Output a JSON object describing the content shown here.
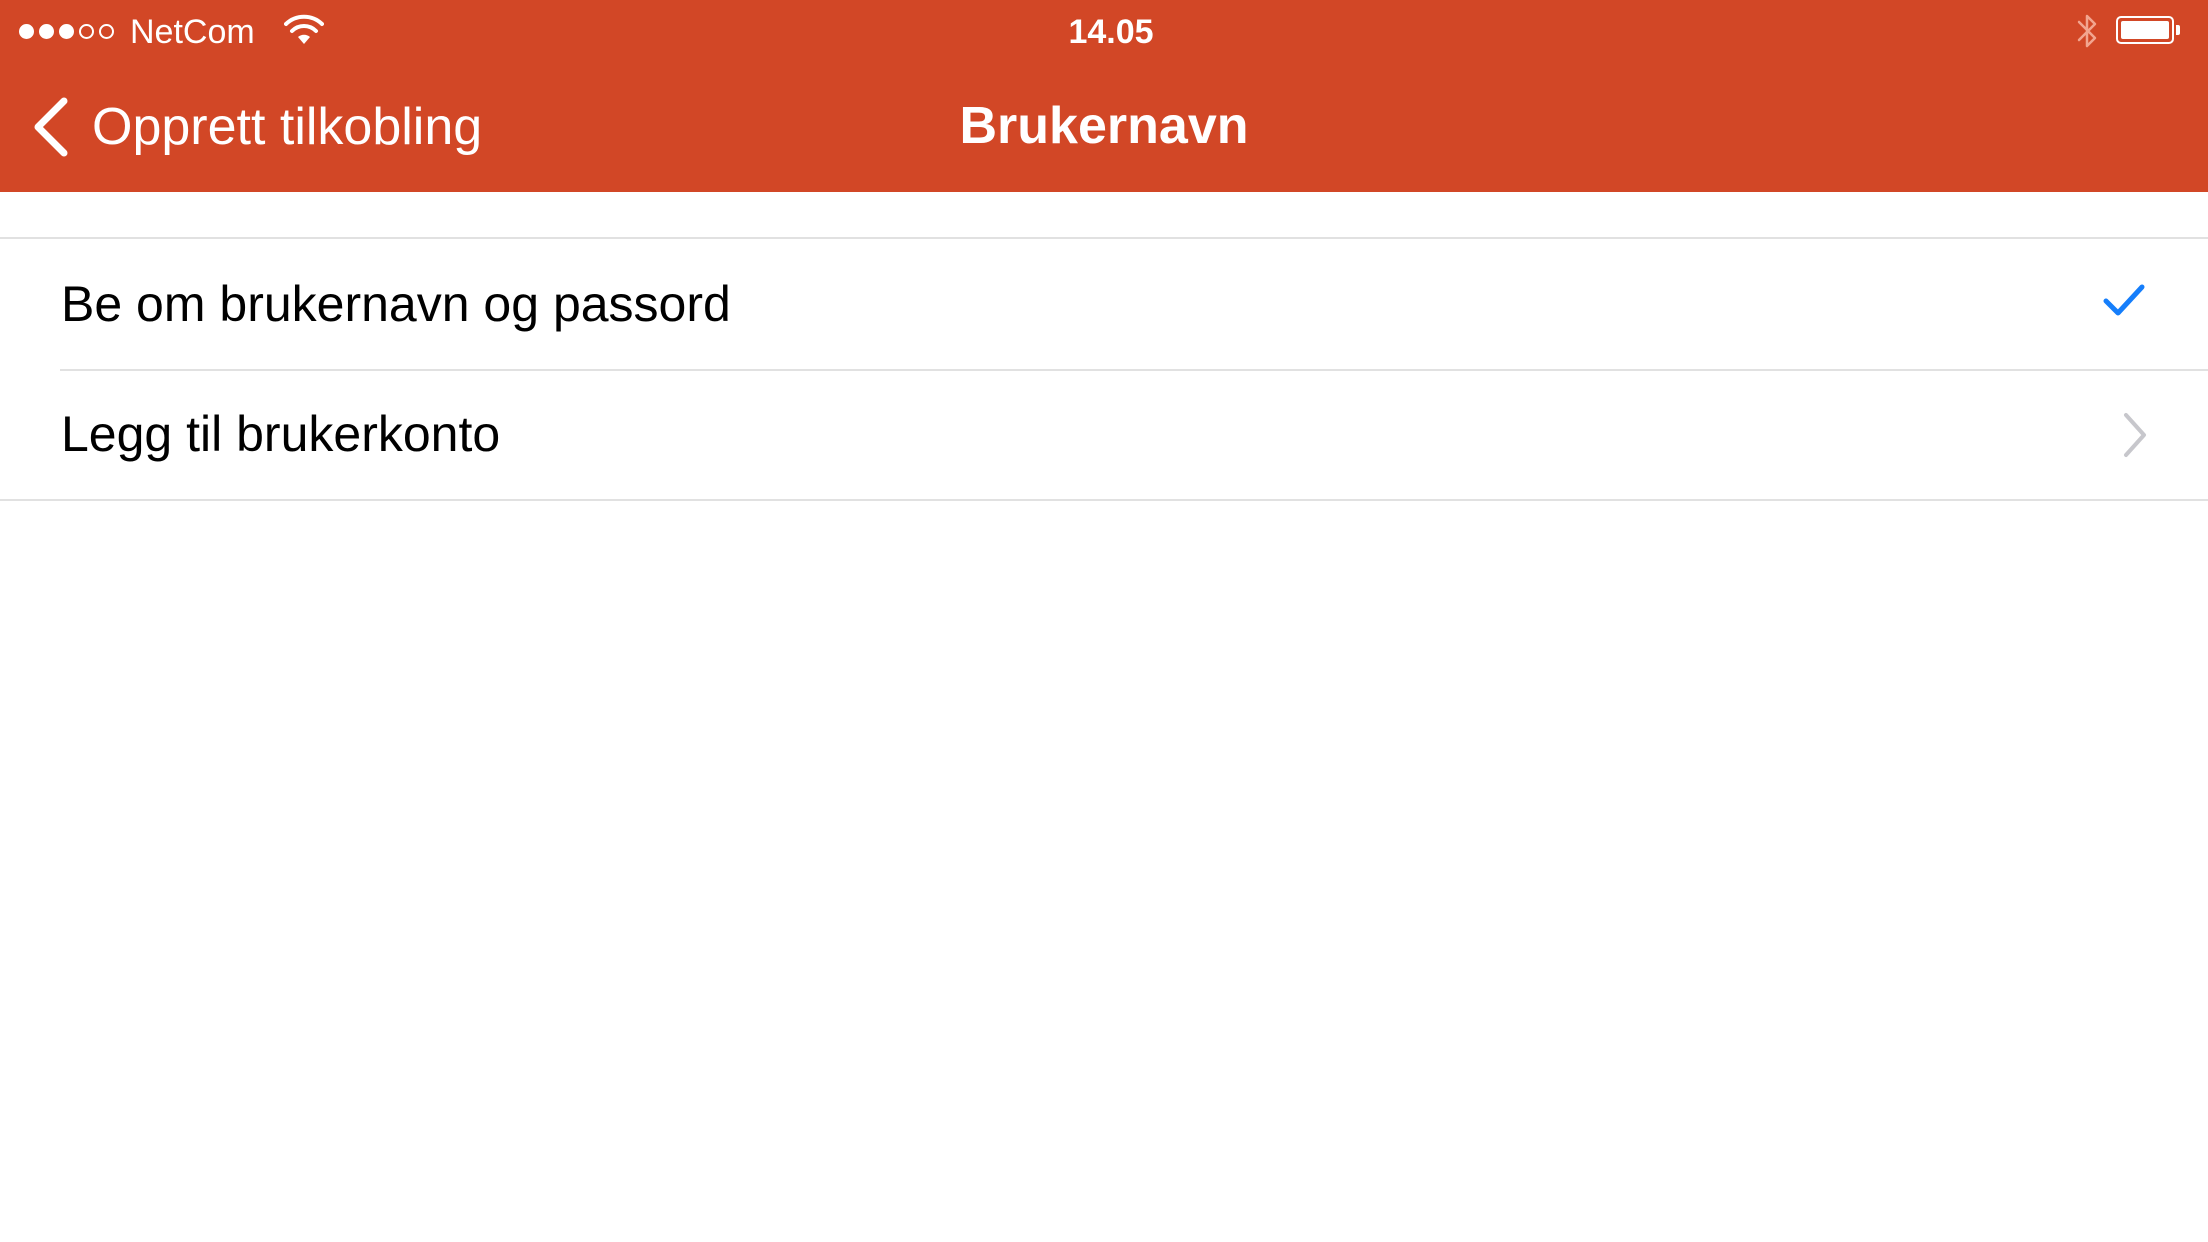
{
  "status_bar": {
    "signal_bars_filled": 3,
    "signal_bars_total": 5,
    "carrier": "NetCom",
    "time": "14.05",
    "wifi_icon": "wifi-icon",
    "bluetooth_icon": "bluetooth-icon",
    "battery_icon": "battery-icon"
  },
  "nav": {
    "back_label": "Opprett tilkobling",
    "back_icon": "chevron-left-icon",
    "title": "Brukernavn"
  },
  "list": {
    "items": [
      {
        "label": "Be om brukernavn og passord",
        "accessory": "checkmark-icon",
        "selected": true
      },
      {
        "label": "Legg til brukerkonto",
        "accessory": "chevron-right-icon"
      }
    ]
  },
  "colors": {
    "header_background": "#D24726",
    "checkmark": "#157EFB",
    "chevron": "#C7C7CC",
    "separator": "#E1E1E1"
  }
}
